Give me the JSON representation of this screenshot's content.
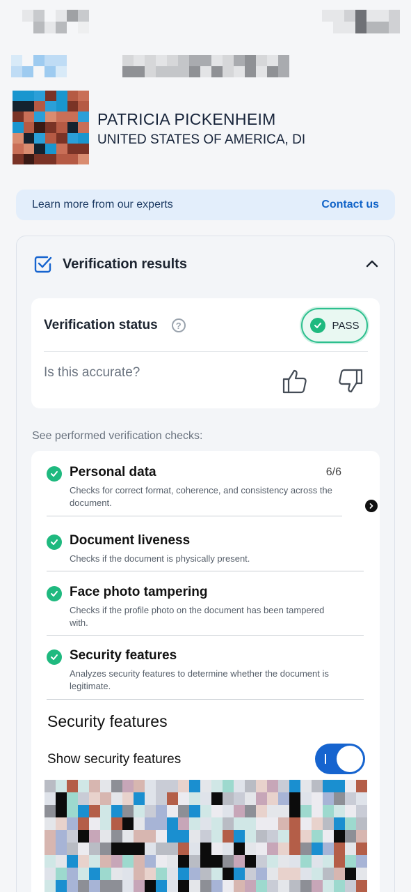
{
  "profile": {
    "name": "PATRICIA PICKENHEIM",
    "country": "UNITED STATES OF AMERICA, DI"
  },
  "promo": {
    "text": "Learn more from our experts",
    "link": "Contact us"
  },
  "results": {
    "title": "Verification results",
    "status_label": "Verification status",
    "help_glyph": "?",
    "status_value": "PASS",
    "accuracy_prompt": "Is this accurate?"
  },
  "checks_intro": "See performed verification checks:",
  "checks": [
    {
      "title": "Personal data",
      "description": "Checks for correct format, coherence, and consistency across the document.",
      "count": "6/6"
    },
    {
      "title": "Document liveness",
      "description": "Checks if the document is physically present."
    },
    {
      "title": "Face photo tampering",
      "description": "Checks if the profile photo on the document has been tampered with."
    },
    {
      "title": "Security features",
      "description": "Analyzes security features to determine whether the document is legitimate."
    }
  ],
  "security": {
    "section_title": "Security features",
    "toggle_label": "Show security features",
    "toggle_on": true
  },
  "colors": {
    "accent": "#1664cf",
    "success": "#1fb97f",
    "promo_bg": "#e3eefb"
  }
}
